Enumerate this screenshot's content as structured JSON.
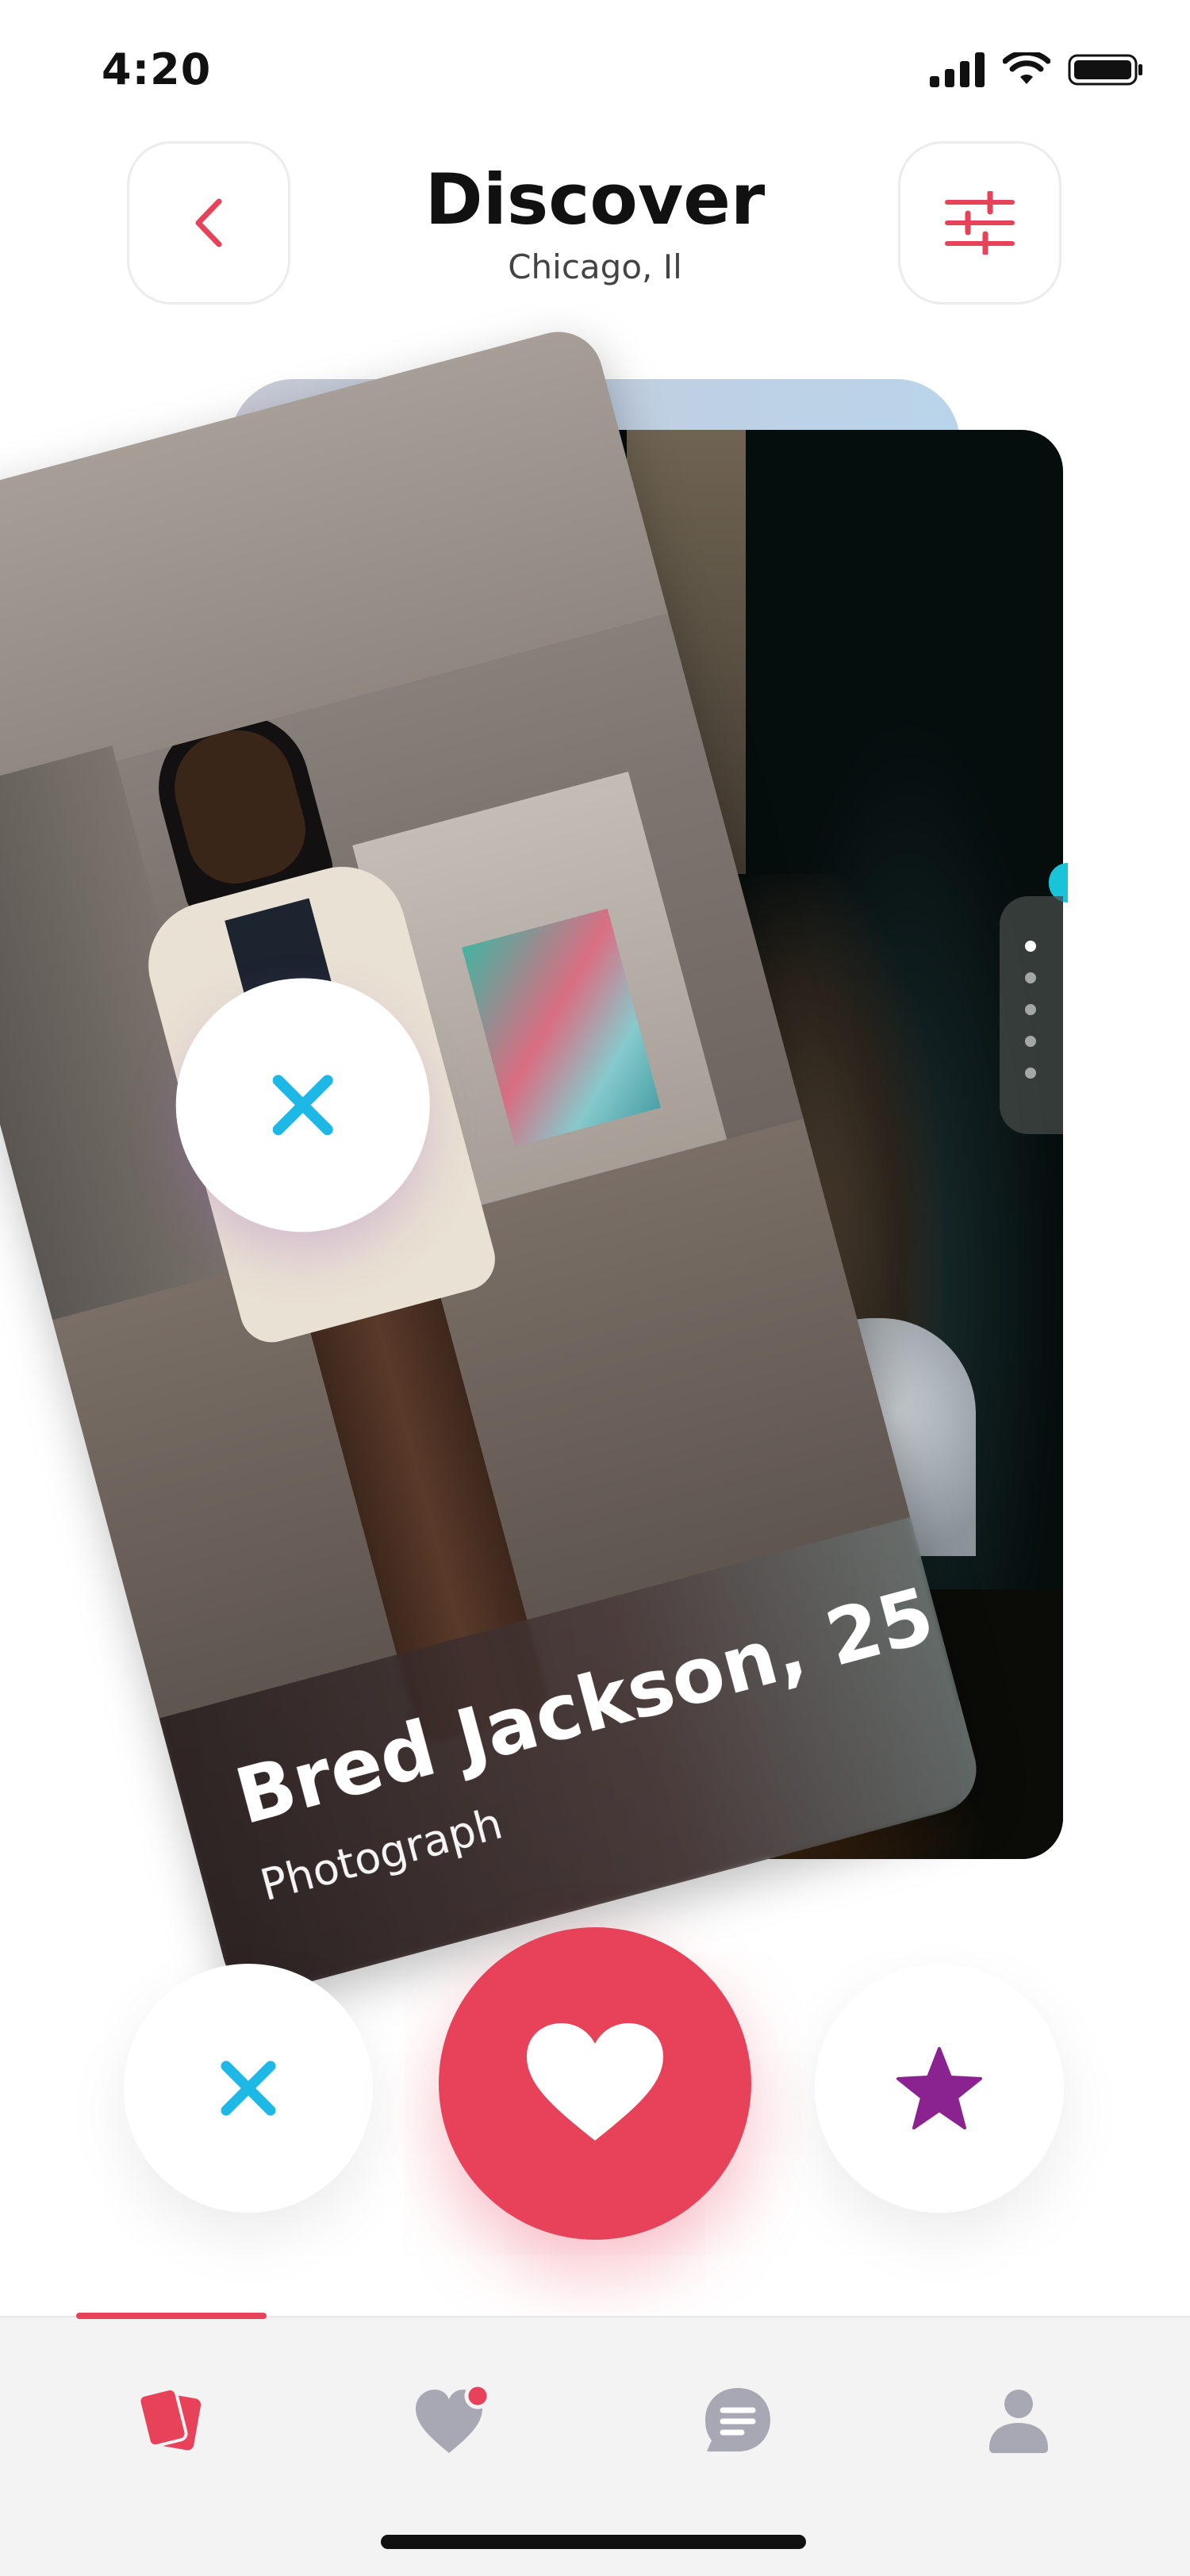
{
  "status_bar": {
    "time": "4:20"
  },
  "header": {
    "title": "Discover",
    "location": "Chicago, Il"
  },
  "profile_card": {
    "name": "Bred Jackson, 25",
    "occupation": "Photograph"
  },
  "pager": {
    "total": 5,
    "active_index": 0
  },
  "colors": {
    "accent_red": "#e8415a",
    "dislike_blue": "#1eb8e6",
    "star_purple": "#8a2390",
    "inactive_gray": "#a8a8b4"
  },
  "tabs": [
    {
      "id": "discover",
      "icon": "cards-icon",
      "active": true
    },
    {
      "id": "matches",
      "icon": "heart-icon",
      "active": false,
      "badge": true
    },
    {
      "id": "messages",
      "icon": "chat-icon",
      "active": false
    },
    {
      "id": "profile",
      "icon": "user-icon",
      "active": false
    }
  ]
}
